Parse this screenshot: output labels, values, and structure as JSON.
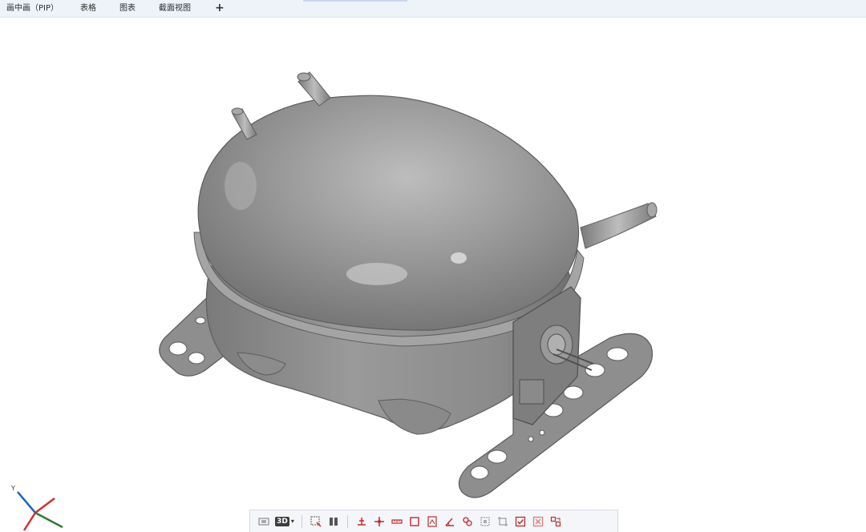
{
  "tabs": [
    {
      "label": "画中画（PIP）"
    },
    {
      "label": "表格"
    },
    {
      "label": "图表"
    },
    {
      "label": "截面视图"
    }
  ],
  "add_tab_label": "+",
  "toolbar": {
    "view_mode_label": "3D",
    "icons": [
      "fit-view-icon",
      "view-3d-icon",
      "select-region-icon",
      "split-view-icon",
      "align-icon",
      "origin-icon",
      "measure-icon",
      "frame-icon",
      "report-icon",
      "angle-icon",
      "link-icon",
      "grid-icon",
      "crop-icon",
      "check-icon",
      "delete-icon",
      "transform-icon"
    ]
  },
  "triad": {
    "y_label": "Y"
  },
  "colors": {
    "tab_bg": "#eef3fa",
    "model_gray": "#8c8c8c",
    "toolbar_red": "#c62828",
    "axis_x": "#d32f2f",
    "axis_y": "#2e7d32",
    "axis_z": "#1565c0"
  }
}
